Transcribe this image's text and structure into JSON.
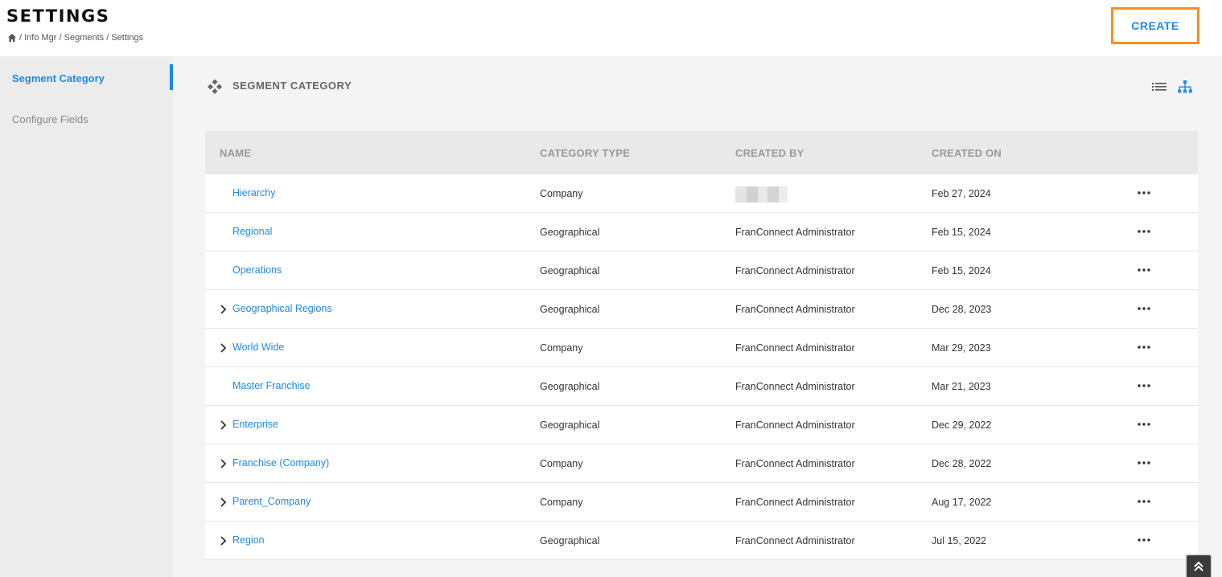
{
  "header": {
    "title": "SETTINGS",
    "breadcrumb": "/ Info Mgr / Segments / Settings",
    "create_label": "CREATE"
  },
  "sidebar": {
    "items": [
      {
        "label": "Segment Category",
        "active": true
      },
      {
        "label": "Configure Fields",
        "active": false
      }
    ]
  },
  "main": {
    "section_title": "SEGMENT CATEGORY",
    "columns": [
      "NAME",
      "CATEGORY TYPE",
      "CREATED BY",
      "CREATED ON"
    ],
    "rows": [
      {
        "name": "Hierarchy",
        "type": "Company",
        "created_by": "",
        "created_on": "Feb 27, 2024",
        "expandable": false,
        "redacted": true
      },
      {
        "name": "Regional",
        "type": "Geographical",
        "created_by": "FranConnect Administrator",
        "created_on": "Feb 15, 2024",
        "expandable": false
      },
      {
        "name": "Operations",
        "type": "Geographical",
        "created_by": "FranConnect Administrator",
        "created_on": "Feb 15, 2024",
        "expandable": false
      },
      {
        "name": "Geographical Regions",
        "type": "Geographical",
        "created_by": "FranConnect Administrator",
        "created_on": "Dec 28, 2023",
        "expandable": true
      },
      {
        "name": "World Wide",
        "type": "Company",
        "created_by": "FranConnect Administrator",
        "created_on": "Mar 29, 2023",
        "expandable": true
      },
      {
        "name": "Master Franchise",
        "type": "Geographical",
        "created_by": "FranConnect Administrator",
        "created_on": "Mar 21, 2023",
        "expandable": false
      },
      {
        "name": "Enterprise",
        "type": "Geographical",
        "created_by": "FranConnect Administrator",
        "created_on": "Dec 29, 2022",
        "expandable": true
      },
      {
        "name": "Franchise (Company)",
        "type": "Company",
        "created_by": "FranConnect Administrator",
        "created_on": "Dec 28, 2022",
        "expandable": true
      },
      {
        "name": "Parent_Company",
        "type": "Company",
        "created_by": "FranConnect Administrator",
        "created_on": "Aug 17, 2022",
        "expandable": true
      },
      {
        "name": "Region",
        "type": "Geographical",
        "created_by": "FranConnect Administrator",
        "created_on": "Jul 15, 2022",
        "expandable": true
      }
    ]
  },
  "colors": {
    "accent": "#1e88e5",
    "create_border": "#f5901e"
  },
  "icons": {
    "home": "home-icon",
    "section": "segment-category-icon",
    "list_view": "list-view-icon",
    "tree_view": "tree-view-icon",
    "more": "more-options-icon",
    "expand": "chevron-right-icon",
    "scroll_top": "double-chevron-up-icon"
  }
}
